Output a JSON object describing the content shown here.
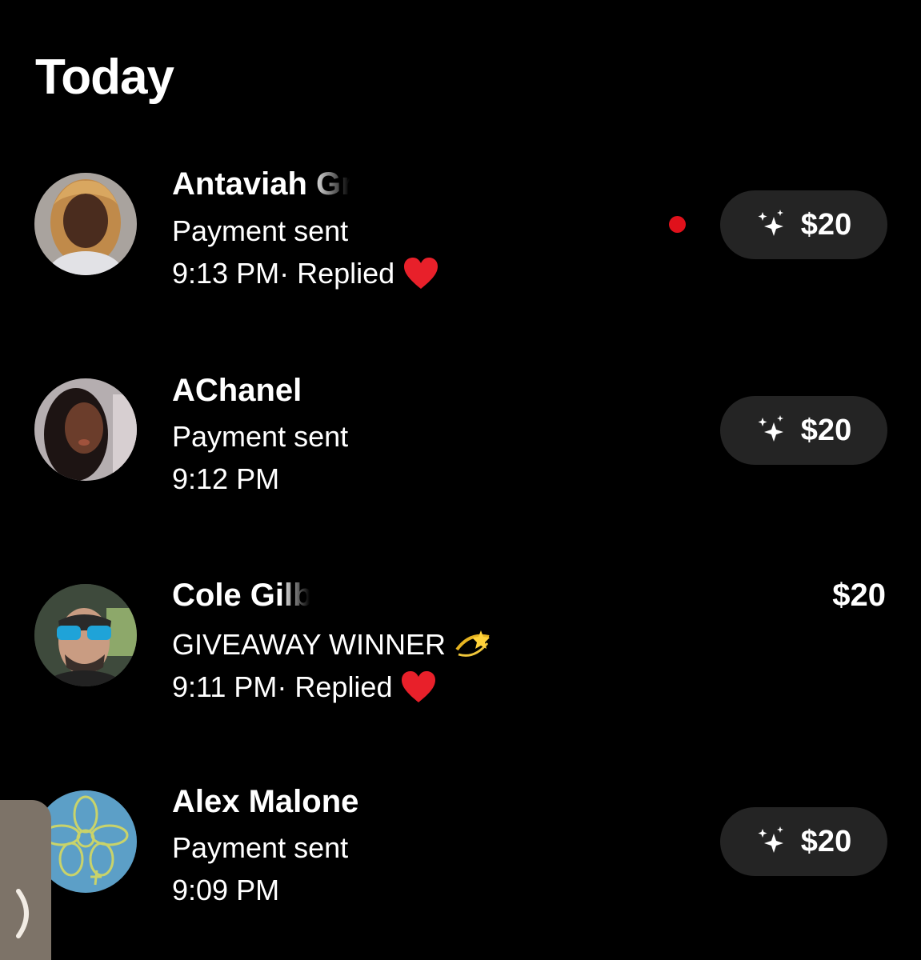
{
  "section_title": "Today",
  "rows": [
    {
      "name_visible": "Antaviah ",
      "name_faded": "Gr",
      "subtitle": "Payment sent",
      "time": "9:13 PM",
      "status": " · Replied",
      "status_emoji": "red-heart",
      "unread": true,
      "amount": "$20",
      "amount_style": "pill",
      "icon": "sparkles-icon"
    },
    {
      "name_visible": "AChanel",
      "name_faded": "",
      "subtitle": "Payment sent",
      "time": "9:12 PM",
      "status": "",
      "unread": false,
      "amount": "$20",
      "amount_style": "pill",
      "icon": "sparkles-icon"
    },
    {
      "name_visible": "Cole Gi",
      "name_faded": "lb",
      "subtitle": "GIVEAWAY WINNER",
      "subtitle_emoji": "dizzy-star",
      "time": "9:11 PM",
      "status": " · Replied",
      "status_emoji": "red-heart",
      "unread": false,
      "amount": "$20",
      "amount_style": "plain"
    },
    {
      "name_visible": "Alex Malone",
      "name_faded": "",
      "subtitle": "Payment sent",
      "time": "9:09 PM",
      "status": "",
      "unread": false,
      "amount": "$20",
      "amount_style": "pill",
      "icon": "sparkles-icon"
    }
  ],
  "side_tab": {
    "icon": "chevron-right-icon"
  },
  "colors": {
    "background": "#000000",
    "pill": "#242424",
    "unread_dot": "#e0111b",
    "side_tab": "#7d7368"
  }
}
